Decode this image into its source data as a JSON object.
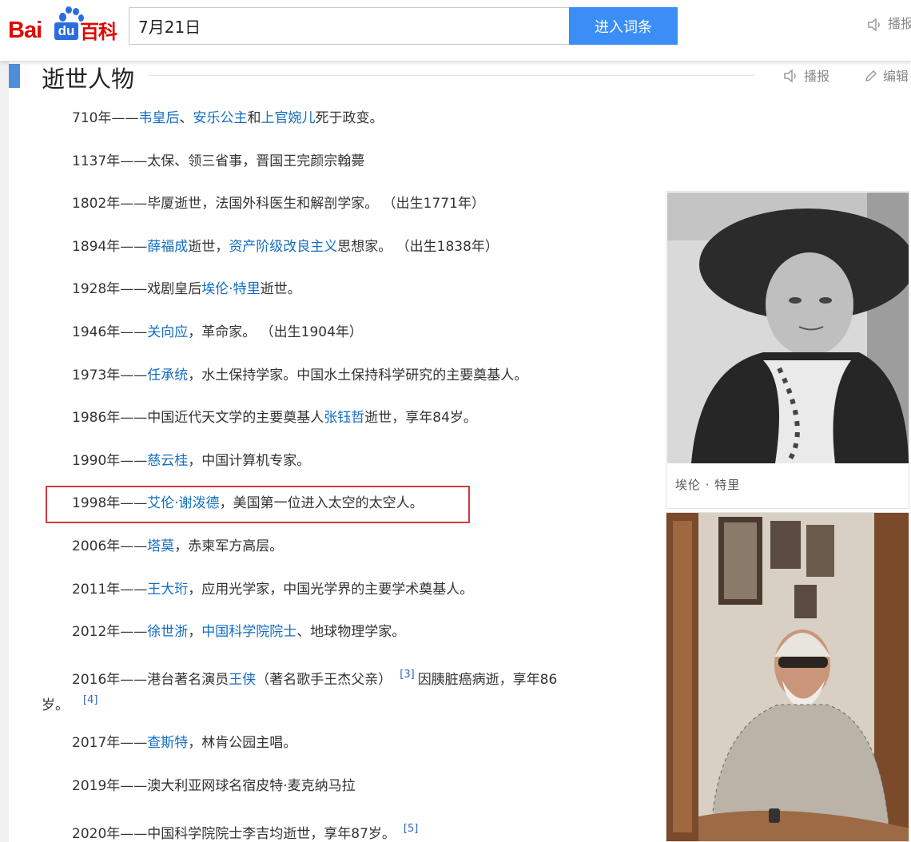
{
  "header": {
    "logo_bai": "Bai",
    "logo_du": "du",
    "logo_baike": "百科",
    "search_value": "7月21日",
    "search_button": "进入词条",
    "broadcast_label": "播报"
  },
  "section": {
    "title": "逝世人物",
    "tools": {
      "broadcast": "播报",
      "edit": "编辑"
    }
  },
  "events": [
    {
      "year": "710年——",
      "parts": [
        [
          "link",
          "韦皇后"
        ],
        [
          "text",
          "、"
        ],
        [
          "link",
          "安乐公主"
        ],
        [
          "text",
          "和"
        ],
        [
          "link",
          "上官婉儿"
        ],
        [
          "text",
          "死于政变。"
        ]
      ]
    },
    {
      "year": "1137年——",
      "parts": [
        [
          "text",
          "太保、领三省事，晋国王完颜宗翰薨"
        ]
      ]
    },
    {
      "year": "1802年——",
      "parts": [
        [
          "text",
          "毕厦逝世，法国外科医生和解剖学家。 （出生1771年）"
        ]
      ]
    },
    {
      "year": "1894年——",
      "parts": [
        [
          "link",
          "薛福成"
        ],
        [
          "text",
          "逝世，"
        ],
        [
          "link",
          "资产阶级改良主义"
        ],
        [
          "text",
          "思想家。 （出生1838年）"
        ]
      ]
    },
    {
      "year": "1928年——",
      "parts": [
        [
          "text",
          "戏剧皇后"
        ],
        [
          "link",
          "埃伦·特里"
        ],
        [
          "text",
          "逝世。"
        ]
      ]
    },
    {
      "year": "1946年——",
      "parts": [
        [
          "link",
          "关向应"
        ],
        [
          "text",
          "，革命家。 （出生1904年）"
        ]
      ]
    },
    {
      "year": "1973年——",
      "parts": [
        [
          "link",
          "任承统"
        ],
        [
          "text",
          "，水土保持学家。中国水土保持科学研究的主要奠基人。"
        ]
      ]
    },
    {
      "year": "1986年——",
      "parts": [
        [
          "text",
          "中国近代天文学的主要奠基人"
        ],
        [
          "link",
          "张钰哲"
        ],
        [
          "text",
          "逝世，享年84岁。"
        ]
      ]
    },
    {
      "year": "1990年——",
      "parts": [
        [
          "link",
          "慈云桂"
        ],
        [
          "text",
          "，中国计算机专家。"
        ]
      ]
    },
    {
      "year": "1998年——",
      "parts": [
        [
          "link",
          "艾伦·谢泼德"
        ],
        [
          "text",
          "，美国第一位进入太空的太空人。"
        ]
      ]
    },
    {
      "year": "2006年——",
      "parts": [
        [
          "link",
          "塔莫"
        ],
        [
          "text",
          "，赤柬军方高层。"
        ]
      ]
    },
    {
      "year": "2011年——",
      "parts": [
        [
          "link",
          "王大珩"
        ],
        [
          "text",
          "，应用光学家，中国光学界的主要学术奠基人。"
        ]
      ]
    },
    {
      "year": "2012年——",
      "parts": [
        [
          "link",
          "徐世浙"
        ],
        [
          "text",
          "，"
        ],
        [
          "link",
          "中国科学院院士"
        ],
        [
          "text",
          "、地球物理学家。"
        ]
      ]
    },
    {
      "year": "2016年——",
      "parts": [
        [
          "text",
          "港台著名演员"
        ],
        [
          "link",
          "王侠"
        ],
        [
          "text",
          "（著名歌手王杰父亲）"
        ],
        [
          "sup",
          "[3]"
        ],
        [
          "text",
          "因胰脏癌病逝，享年86"
        ]
      ]
    },
    {
      "year": "2017年——",
      "parts": [
        [
          "link",
          "查斯特"
        ],
        [
          "text",
          "，林肯公园主唱。"
        ]
      ]
    },
    {
      "year": "2019年——",
      "parts": [
        [
          "text",
          "澳大利亚网球名宿皮特·麦克纳马拉"
        ]
      ]
    },
    {
      "year": "2020年——",
      "parts": [
        [
          "text",
          "中国科学院院士李吉均逝世，享年87岁。"
        ],
        [
          "sup",
          "[5]"
        ]
      ]
    }
  ],
  "event_2016_continuation": {
    "text": "岁。",
    "ref": "[4]"
  },
  "figures": [
    {
      "caption": "埃伦 · 特里"
    },
    {
      "caption": ""
    }
  ],
  "colors": {
    "link": "#136ec2",
    "search_button": "#3a8ef6",
    "logo_red": "#e10602",
    "logo_blue": "#2b6de0",
    "highlight_box": "#d33b3b",
    "section_marker": "#4f8fd9"
  }
}
